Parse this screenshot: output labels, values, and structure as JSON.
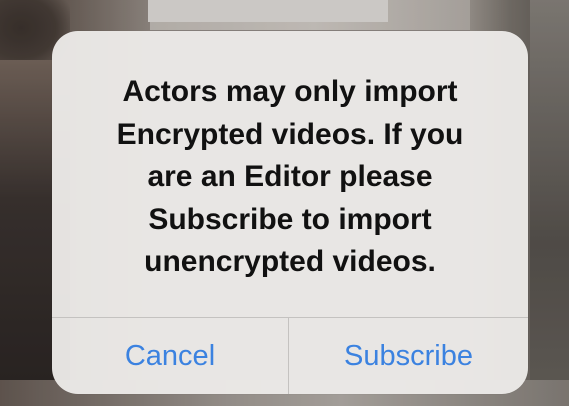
{
  "alert": {
    "message": "Actors may only import\nEncrypted videos. If you\nare an Editor please\nSubscribe to import\nunencrypted videos.",
    "buttons": {
      "cancel_label": "Cancel",
      "subscribe_label": "Subscribe"
    }
  },
  "colors": {
    "button_text": "#3b82e0",
    "alert_background": "#eceae8",
    "message_text": "#111111"
  }
}
